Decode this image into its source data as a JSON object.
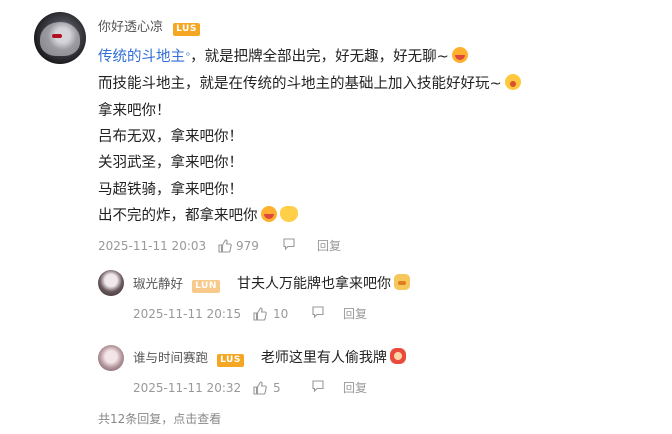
{
  "main_comment": {
    "username": "你好透心凉",
    "badge": "LUS",
    "lines": [
      {
        "link": "传统的斗地主",
        "rest": "，就是把牌全部出完，好无趣，好无聊~"
      },
      {
        "text": "而技能斗地主，就是在传统的斗地主的基础上加入技能好好玩~"
      },
      {
        "text": "拿来吧你！"
      },
      {
        "text": "吕布无双，拿来吧你！"
      },
      {
        "text": "关羽武圣，拿来吧你！"
      },
      {
        "text": "马超铁骑，拿来吧你！"
      },
      {
        "text": "出不完的炸，都拿来吧你"
      }
    ],
    "timestamp": "2025-11-11 20:03",
    "likes": "979",
    "reply_label": "回复",
    "emojis": [
      "laughing-emoji",
      "yawning-emoji",
      "laughing-emoji",
      "hands-emoji"
    ]
  },
  "replies": [
    {
      "username": "琡光静好",
      "badge": "LUN",
      "text": "甘夫人万能牌也拿来吧你",
      "timestamp": "2025-11-11 20:15",
      "likes": "10",
      "reply_label": "回复",
      "emoji": "cat-emoji"
    },
    {
      "username": "谁与时间赛跑",
      "badge": "LUS",
      "text": "老师这里有人偷我牌",
      "timestamp": "2025-11-11 20:32",
      "likes": "5",
      "reply_label": "回复",
      "emoji": "lion-emoji"
    }
  ],
  "footer": {
    "more_replies": "共12条回复，点击查看"
  },
  "colors": {
    "link": "#2f6fd6",
    "badge": "#f5a623",
    "meta": "#999999",
    "text": "#222222"
  }
}
